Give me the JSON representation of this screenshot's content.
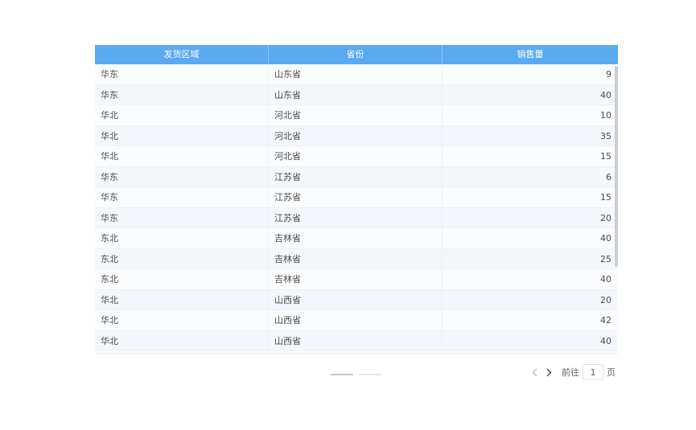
{
  "table": {
    "headers": [
      "发货区域",
      "省份",
      "销售量"
    ],
    "rows": [
      [
        "华东",
        "山东省",
        "9"
      ],
      [
        "华东",
        "山东省",
        "40"
      ],
      [
        "华北",
        "河北省",
        "10"
      ],
      [
        "华北",
        "河北省",
        "35"
      ],
      [
        "华北",
        "河北省",
        "15"
      ],
      [
        "华东",
        "江苏省",
        "6"
      ],
      [
        "华东",
        "江苏省",
        "15"
      ],
      [
        "华东",
        "江苏省",
        "20"
      ],
      [
        "东北",
        "吉林省",
        "40"
      ],
      [
        "东北",
        "吉林省",
        "25"
      ],
      [
        "东北",
        "吉林省",
        "40"
      ],
      [
        "华北",
        "山西省",
        "20"
      ],
      [
        "华北",
        "山西省",
        "42"
      ],
      [
        "华北",
        "山西省",
        "40"
      ]
    ]
  },
  "pagination": {
    "goto_label": "前往",
    "current_page": "1",
    "page_suffix": "页",
    "prev_icon": "chevron-left-icon",
    "next_icon": "chevron-right-icon",
    "dots": 2,
    "active_dot": 0
  },
  "colors": {
    "header_bg": "#5aaaf2",
    "row_odd": "#fbfcfe",
    "row_even": "#f4f7fb"
  }
}
